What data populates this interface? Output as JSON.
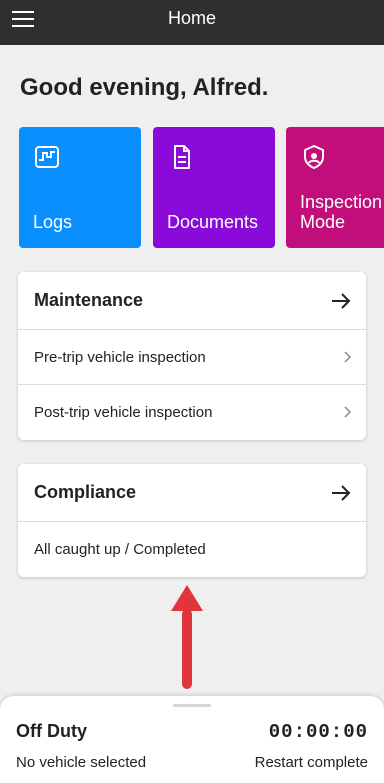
{
  "header": {
    "title": "Home",
    "menu_icon": "hamburger-menu-icon"
  },
  "greeting": "Good evening, Alfred.",
  "tiles": [
    {
      "label": "Logs",
      "color": "#0a8fff",
      "icon": "logs-chart-icon"
    },
    {
      "label": "Documents",
      "color": "#8a0bd9",
      "icon": "document-icon"
    },
    {
      "label": "Inspection Mode",
      "color": "#c20e7a",
      "icon": "shield-badge-icon"
    }
  ],
  "maintenance": {
    "title": "Maintenance",
    "items": [
      {
        "label": "Pre-trip vehicle inspection"
      },
      {
        "label": "Post-trip vehicle inspection"
      }
    ]
  },
  "compliance": {
    "title": "Compliance",
    "status": "All caught up / Completed"
  },
  "annotation": {
    "color": "#e0353b"
  },
  "bottom_panel": {
    "duty_status": "Off Duty",
    "timer": "00:00:00",
    "vehicle_status": "No vehicle selected",
    "restart_status": "Restart complete"
  }
}
